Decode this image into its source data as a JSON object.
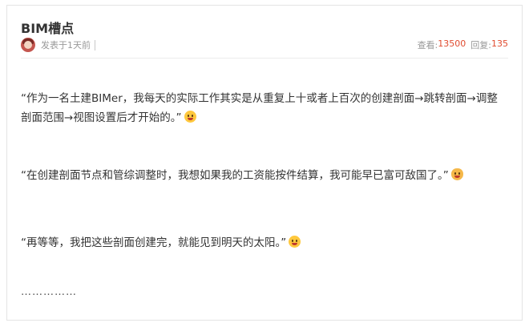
{
  "post": {
    "title": "BIM槽点",
    "posted": "发表于1天前",
    "views_label": "查看:",
    "views": "13500",
    "replies_label": "回复:",
    "replies": "135"
  },
  "content": {
    "p1": "“作为一名土建BIMer，我每天的实际工作其实是从重复上十或者上百次的创建剖面→跳转剖面→调整剖面范围→视图设置后才开始的。”",
    "p2": "“在创建剖面节点和管综调整时，我想如果我的工资能按件结算，我可能早已富可敌国了。”",
    "p3": "“再等等，我把这些剖面创建完，就能见到明天的太阳。”",
    "ellipsis": "……………"
  },
  "icons": {
    "avatar": "user-avatar",
    "emoji1": "flushed-face-emoji",
    "emoji2": "cat-face-emoji",
    "emoji3": "zany-face-emoji"
  }
}
